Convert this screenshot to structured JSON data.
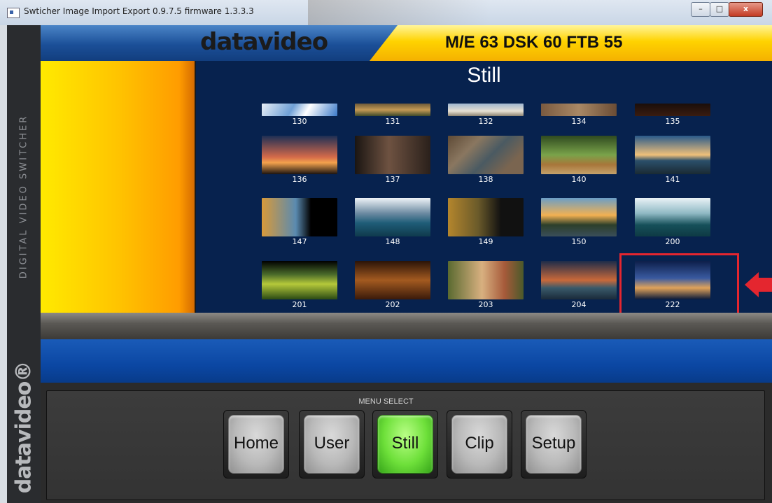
{
  "window": {
    "title": "Swticher Image Import Export  0.9.7.5  firmware  1.3.3.3",
    "controls": {
      "minimize": "–",
      "maximize": "□",
      "close": "x"
    }
  },
  "sidebar": {
    "vertical_text": "DIGITAL VIDEO SWITCHER",
    "logo": "datavideo®"
  },
  "header": {
    "logo": "datavideo",
    "status": "M/E 63  DSK 60  FTB 55"
  },
  "still": {
    "heading": "Still",
    "thumbnails": [
      {
        "number": "130",
        "image": "abstract-blue-white-photo"
      },
      {
        "number": "131",
        "image": "landscape-horizon-photo"
      },
      {
        "number": "132",
        "image": "sky-clouds-photo"
      },
      {
        "number": "134",
        "image": "brown-texture-photo"
      },
      {
        "number": "135",
        "image": "dark-photo"
      },
      {
        "number": "136",
        "image": "sunset-tree-balloon-photo"
      },
      {
        "number": "137",
        "image": "portrait-woman-photo"
      },
      {
        "number": "138",
        "image": "stone-wall-photo"
      },
      {
        "number": "140",
        "image": "orchard-path-woman-photo"
      },
      {
        "number": "141",
        "image": "lake-sunset-dock-photo"
      },
      {
        "number": "147",
        "image": "autumn-lake-photo"
      },
      {
        "number": "148",
        "image": "mountain-lake-photo"
      },
      {
        "number": "149",
        "image": "autumn-forest-photo"
      },
      {
        "number": "150",
        "image": "river-sunset-photo"
      },
      {
        "number": "200",
        "image": "penguins-iceberg-photo"
      },
      {
        "number": "201",
        "image": "green-hills-photo"
      },
      {
        "number": "202",
        "image": "dark-orange-ruins-photo"
      },
      {
        "number": "203",
        "image": "orchard-woman-photo"
      },
      {
        "number": "204",
        "image": "lake-sunset-photo"
      },
      {
        "number": "222",
        "image": "city-night-skyline-photo"
      }
    ],
    "selected": "222"
  },
  "menu": {
    "label": "MENU SELECT",
    "buttons": [
      "Home",
      "User",
      "Still",
      "Clip",
      "Setup"
    ],
    "active": "Still"
  },
  "colors": {
    "highlight": "#e4262f",
    "active_button": "#6ee03a",
    "panel_bg": "#07224e"
  }
}
